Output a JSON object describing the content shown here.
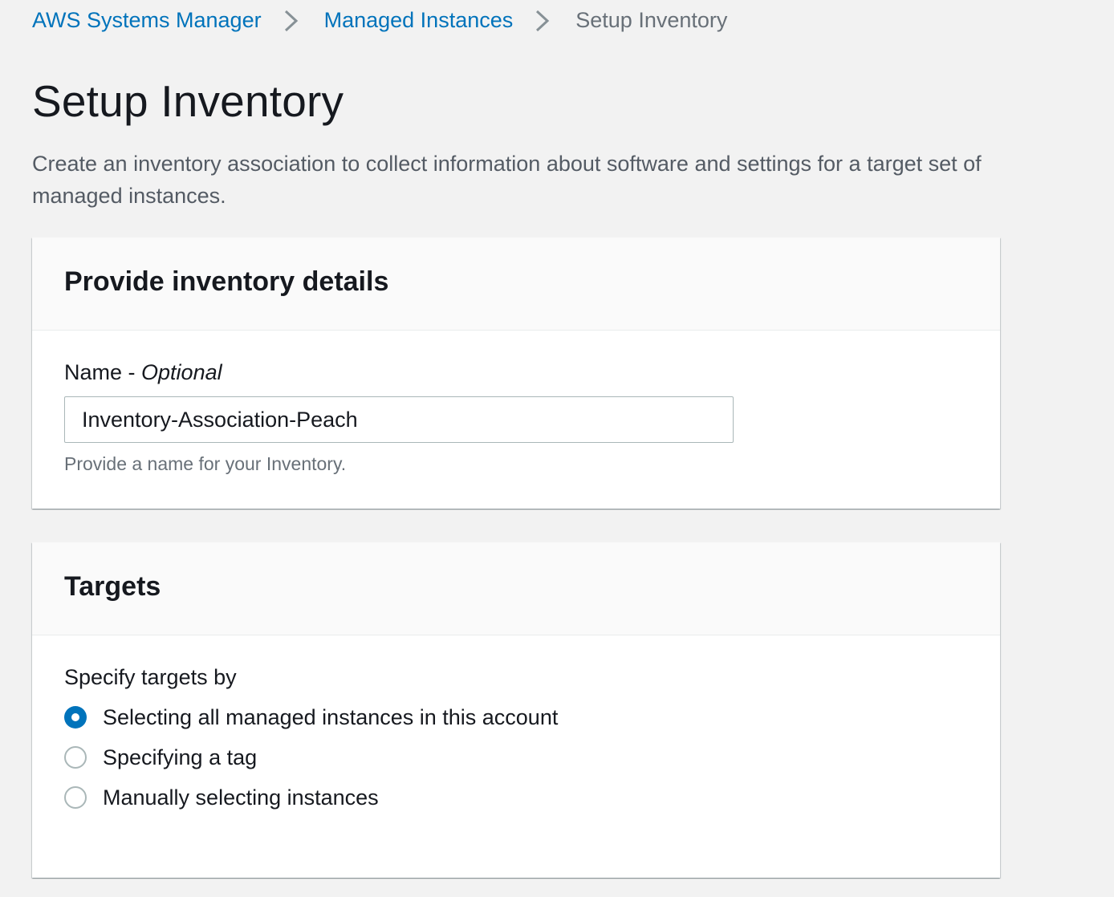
{
  "breadcrumb": {
    "items": [
      {
        "label": "AWS Systems Manager"
      },
      {
        "label": "Managed Instances"
      },
      {
        "label": "Setup Inventory"
      }
    ]
  },
  "page": {
    "title": "Setup Inventory",
    "description": "Create an inventory association to collect information about software and settings for a target set of managed instances."
  },
  "details_panel": {
    "title": "Provide inventory details",
    "name_label": "Name - ",
    "name_optional": "Optional",
    "name_value": "Inventory-Association-Peach",
    "name_hint": "Provide a name for your Inventory."
  },
  "targets_panel": {
    "title": "Targets",
    "group_label": "Specify targets by",
    "options": [
      {
        "label": "Selecting all managed instances in this account",
        "selected": true
      },
      {
        "label": "Specifying a tag",
        "selected": false
      },
      {
        "label": "Manually selecting instances",
        "selected": false
      }
    ]
  },
  "colors": {
    "link": "#0073bb",
    "page_background": "#f2f2f2",
    "radio_selected": "#0073bb"
  },
  "icons": {
    "breadcrumb_separator": "chevron-right-icon"
  }
}
